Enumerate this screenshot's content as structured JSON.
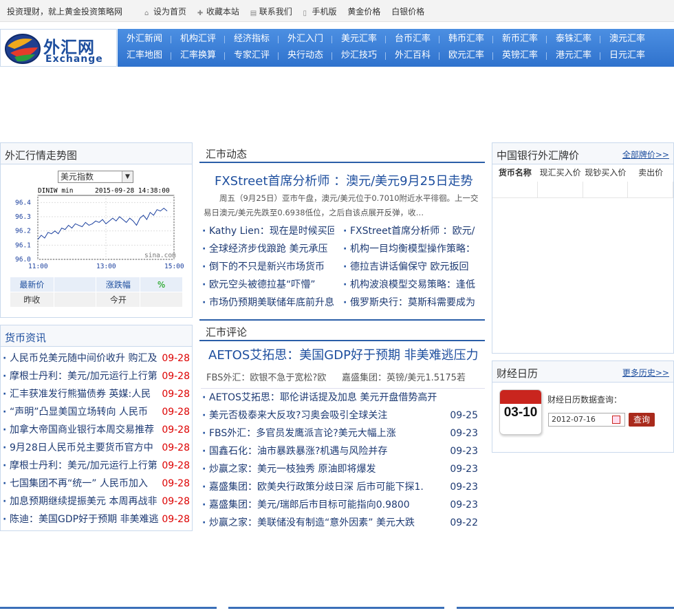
{
  "topbar": {
    "slogan": "投资理财，就上黄金投资策略网",
    "links": [
      "设为首页",
      "收藏本站",
      "联系我们",
      "手机版"
    ],
    "red_links": [
      "黄金价格",
      "白银价格"
    ]
  },
  "logo": {
    "cn": "外汇网",
    "en": "Exchange"
  },
  "nav": {
    "row1": [
      "外汇新闻",
      "机构汇评",
      "经济指标",
      "外汇入门",
      "美元汇率",
      "台币汇率",
      "韩币汇率",
      "新币汇率",
      "泰铢汇率",
      "澳元汇率"
    ],
    "row2": [
      "汇率地图",
      "汇率换算",
      "专家汇评",
      "央行动态",
      "炒汇技巧",
      "外汇百科",
      "欧元汇率",
      "英镑汇率",
      "港元汇率",
      "日元汇率"
    ]
  },
  "forex_panel": {
    "title": "外汇行情走势图",
    "select_value": "美元指数",
    "chart_header_left": "DINIW min",
    "chart_header_right": "2015-09-28 14:38:00",
    "watermark": "sina.com",
    "quote_labels": {
      "latest": "最新价",
      "change_pct": "涨跌幅",
      "pct_sign": "%",
      "prev_close": "昨收",
      "open": "今开"
    }
  },
  "chart_data": {
    "type": "line",
    "title": "DINIW min",
    "x_ticks": [
      "11:00",
      "13:00",
      "15:00"
    ],
    "y_ticks": [
      96.0,
      96.1,
      96.2,
      96.3,
      96.4
    ],
    "ylim": [
      96.0,
      96.45
    ],
    "xlim": [
      0,
      240
    ],
    "x": [
      0,
      6,
      12,
      18,
      24,
      30,
      36,
      42,
      48,
      54,
      60,
      66,
      72,
      78,
      84,
      90,
      96,
      102,
      108,
      114,
      120,
      126,
      132,
      138,
      144,
      150,
      156,
      162,
      168,
      174,
      180,
      186,
      192,
      198,
      204,
      210,
      216,
      222,
      228
    ],
    "values": [
      96.14,
      96.17,
      96.15,
      96.19,
      96.18,
      96.2,
      96.18,
      96.22,
      96.21,
      96.24,
      96.22,
      96.25,
      96.24,
      96.23,
      96.26,
      96.24,
      96.25,
      96.27,
      96.26,
      96.28,
      96.25,
      96.27,
      96.29,
      96.27,
      96.3,
      96.28,
      96.26,
      96.29,
      96.27,
      96.24,
      96.29,
      96.31,
      96.28,
      96.33,
      96.31,
      96.35,
      96.34,
      96.36,
      96.34
    ],
    "grid": true
  },
  "money_news": {
    "title": "货币资讯",
    "items": [
      {
        "text": "人民币兑美元随中间价收升 购汇及",
        "date": "09-28"
      },
      {
        "text": "摩根士丹利：美元/加元运行上行第",
        "date": "09-28"
      },
      {
        "text": "汇丰获准发行熊猫债券 英媒:人民",
        "date": "09-28"
      },
      {
        "text": "“声明”凸显美国立场转向 人民币",
        "date": "09-28"
      },
      {
        "text": "加拿大帝国商业银行本周交易推荐",
        "date": "09-28"
      },
      {
        "text": "9月28日人民币兑主要货币官方中",
        "date": "09-28"
      },
      {
        "text": "摩根士丹利：美元/加元运行上行第",
        "date": "09-28"
      },
      {
        "text": "七国集团不再“统一” 人民币加入",
        "date": "09-28"
      },
      {
        "text": "加息预期继续提振美元 本周再战非",
        "date": "09-28"
      },
      {
        "text": "陈迪：美国GDP好于预期 非美难逃",
        "date": "09-28"
      }
    ]
  },
  "market_news": {
    "title": "汇市动态",
    "headline": "FXStreet首席分析师 ：澳元/美元9月25日走势",
    "summary": "周五（9月25日）亚市午盘，澳元/美元位于0.7010附近水平徘徊。上一交易日澳元/美元先跌至0.6938低位，之后自该点展开反弹，收…",
    "left": [
      "Kathy Lien：现在是时候买回",
      "全球经济步伐踉跄 美元承压",
      "倒下的不只是新兴市场货币",
      "欧元空头被德拉基“吓懵”",
      "市场仍预期美联储年底前升息"
    ],
    "right": [
      "FXStreet首席分析师 ：欧元/",
      "机构一目均衡模型操作策略：",
      "德拉吉讲话偏保守 欧元扳回",
      "机构波浪模型交易策略：逢低",
      "俄罗斯央行：莫斯科需要成为"
    ]
  },
  "market_comment": {
    "title": "汇市评论",
    "headline": "AETOS艾拓思：美国GDP好于预期 非美难逃压力",
    "sub_left": "FBS外汇：欧银不急于宽松?欧",
    "sub_right": "嘉盛集团：英镑/美元1.5175若",
    "items": [
      {
        "text": "AETOS艾拓思：耶伦讲话提及加息 美元开盘借势高开",
        "date": ""
      },
      {
        "text": "美元否极泰来大反攻?习奥会吸引全球关注",
        "date": "09-25"
      },
      {
        "text": "FBS外汇：多官员发鹰派言论?美元大幅上涨",
        "date": "09-23"
      },
      {
        "text": "国鑫石化：油市暴跌暴涨?机遇与风险并存",
        "date": "09-23"
      },
      {
        "text": "炒赢之家：美元一枝独秀 原油即将爆发",
        "date": "09-23"
      },
      {
        "text": "嘉盛集团：欧美央行政策分歧日深 后市可能下探1.",
        "date": "09-23"
      },
      {
        "text": "嘉盛集团：美元/瑞郎后市目标可能指向0.9800",
        "date": "09-23"
      },
      {
        "text": "炒赢之家：美联储没有制造“意外因素” 美元大跌",
        "date": "09-22"
      }
    ]
  },
  "bank_rates": {
    "title": "中国银行外汇牌价",
    "more": "全部牌价>>",
    "columns": [
      "货币名称",
      "现汇买入价",
      "现钞买入价",
      "卖出价"
    ]
  },
  "calendar": {
    "title": "财经日历",
    "more": "更多历史>>",
    "icon_date": "03-10",
    "label": "财经日历数据查询：",
    "input_value": "2012-07-16",
    "button": "查询"
  }
}
